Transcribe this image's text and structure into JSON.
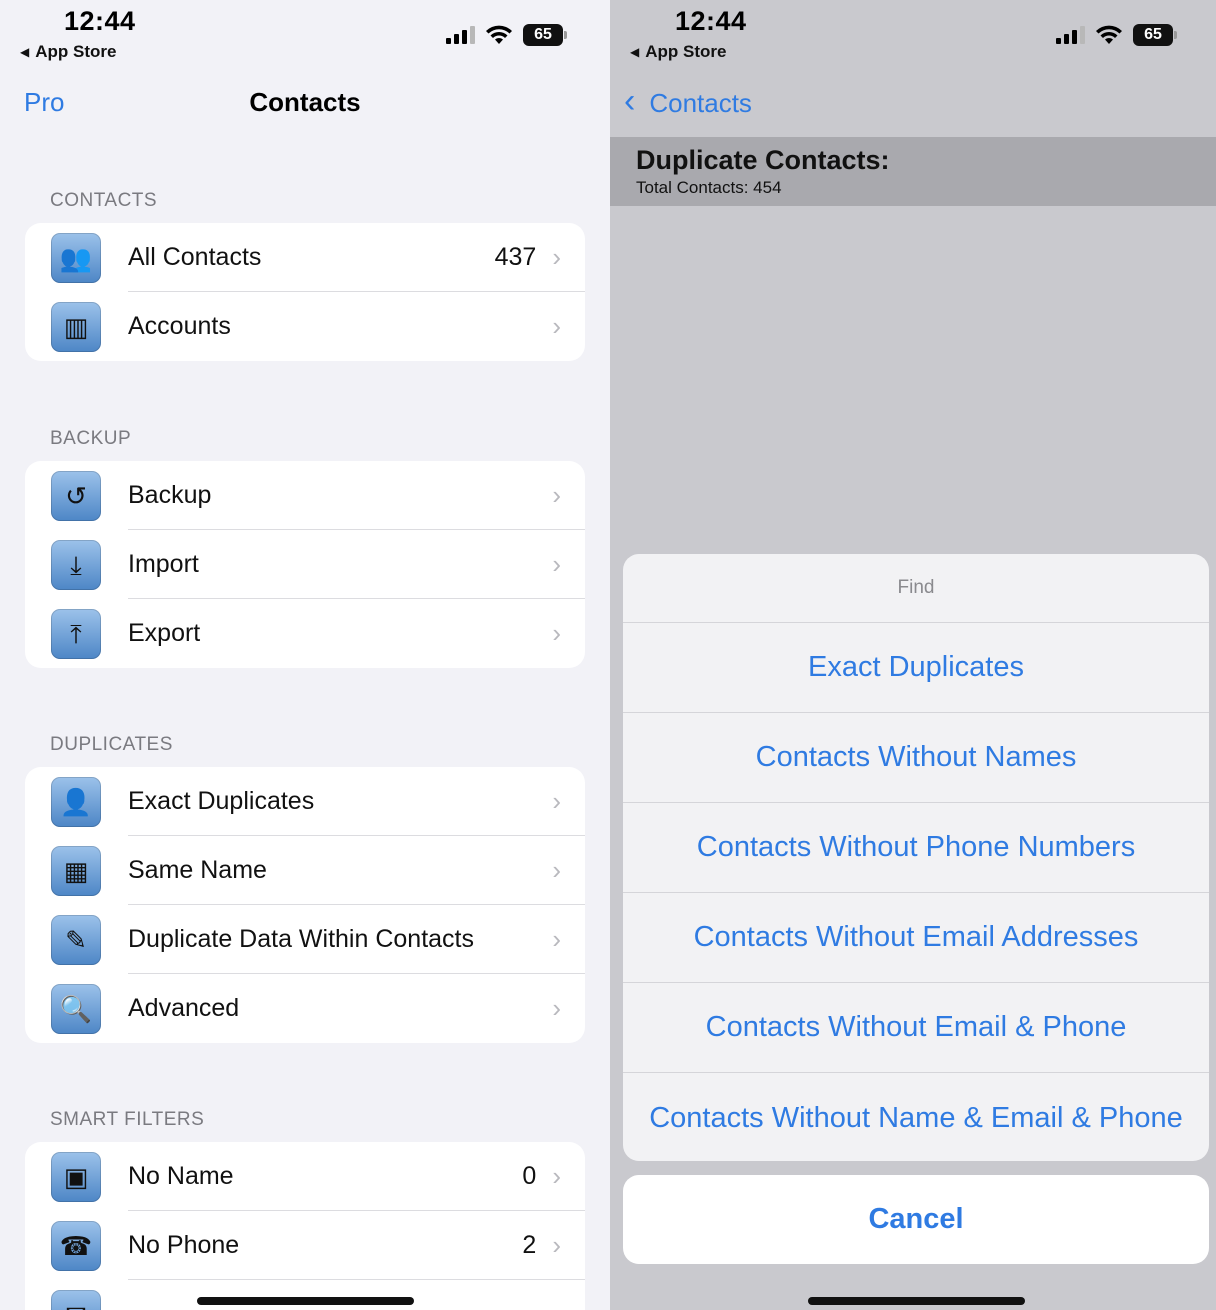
{
  "left": {
    "status": {
      "time": "12:44",
      "back_app": "App Store",
      "battery": "65"
    },
    "nav": {
      "back_label": "Pro",
      "title": "Contacts"
    },
    "sections": {
      "contacts": {
        "header": "CONTACTS",
        "items": [
          {
            "label": "All Contacts",
            "count": "437",
            "icon": "people-icon"
          },
          {
            "label": "Accounts",
            "count": "",
            "icon": "binders-icon"
          }
        ]
      },
      "backup": {
        "header": "BACKUP",
        "items": [
          {
            "label": "Backup",
            "icon": "restore-icon"
          },
          {
            "label": "Import",
            "icon": "import-tray-icon"
          },
          {
            "label": "Export",
            "icon": "export-tray-icon"
          }
        ]
      },
      "duplicates": {
        "header": "DUPLICATES",
        "items": [
          {
            "label": "Exact Duplicates",
            "icon": "duplicate-person-icon"
          },
          {
            "label": "Same Name",
            "icon": "same-name-icon"
          },
          {
            "label": "Duplicate Data Within Contacts",
            "icon": "card-edit-icon"
          },
          {
            "label": "Advanced",
            "icon": "magnifier-icon"
          }
        ]
      },
      "smart_filters": {
        "header": "SMART FILTERS",
        "items": [
          {
            "label": "No Name",
            "count": "0",
            "icon": "no-name-card-icon"
          },
          {
            "label": "No Phone",
            "count": "2",
            "icon": "no-phone-icon"
          }
        ]
      }
    }
  },
  "right": {
    "status": {
      "time": "12:44",
      "back_app": "App Store",
      "battery": "65"
    },
    "nav": {
      "back_label": "Contacts"
    },
    "header": {
      "title": "Duplicate Contacts:",
      "subtitle": "Total Contacts: 454"
    },
    "sheet": {
      "title": "Find",
      "options": [
        "Exact Duplicates",
        "Contacts Without Names",
        "Contacts Without Phone Numbers",
        "Contacts Without Email Addresses",
        "Contacts Without Email & Phone",
        "Contacts Without Name & Email & Phone"
      ],
      "cancel": "Cancel"
    }
  },
  "colors": {
    "accent": "#2f7be2",
    "background": "#f2f2f7",
    "dimmed": "#c9c9ce"
  }
}
